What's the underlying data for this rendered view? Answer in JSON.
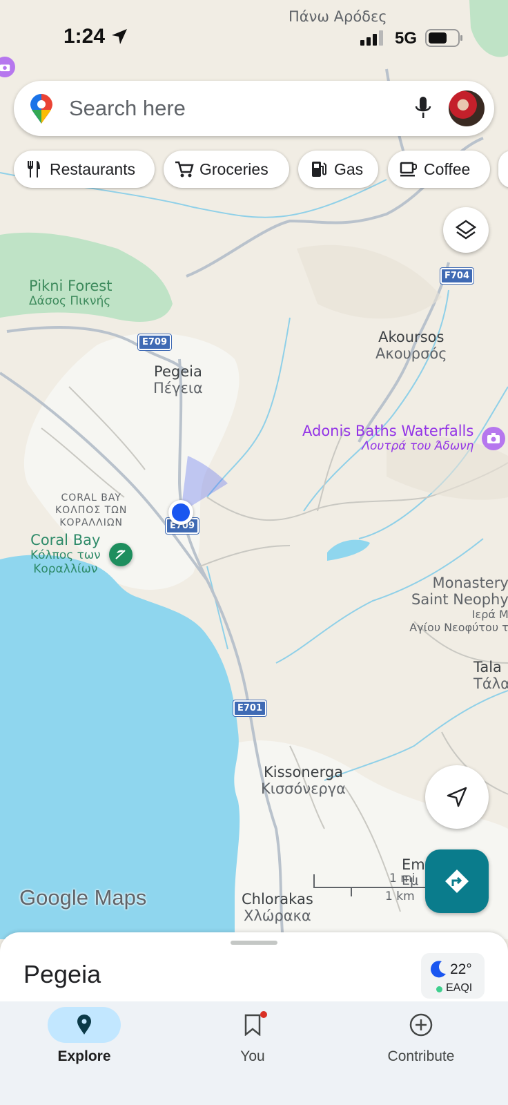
{
  "status_bar": {
    "time": "1:24",
    "network": "5G"
  },
  "search": {
    "placeholder": "Search here"
  },
  "chips": [
    {
      "label": "Restaurants",
      "icon": "fork-knife-icon"
    },
    {
      "label": "Groceries",
      "icon": "cart-icon"
    },
    {
      "label": "Gas",
      "icon": "gas-pump-icon"
    },
    {
      "label": "Coffee",
      "icon": "coffee-cup-icon"
    }
  ],
  "map": {
    "places": {
      "pano_arodes": "Πάνω Αρόδες",
      "pikni_forest": "Pikni Forest",
      "pikni_forest_gr": "Δάσος Πικνής",
      "pegeia": "Pegeia",
      "pegeia_gr": "Πέγεια",
      "akoursos": "Akoursos",
      "akoursos_gr": "Ακουρσός",
      "adonis": "Adonis Baths Waterfalls",
      "adonis_gr": "Λουτρά του Άδωνη",
      "coral_bay_area_1": "CORAL BAY",
      "coral_bay_area_2": "ΚΟΛΠΟΣ ΤΩΝ",
      "coral_bay_area_3": "ΚΟΡΑΛΛΙΩΝ",
      "coral_bay": "Coral Bay",
      "coral_bay_gr_1": "Κόλπος των",
      "coral_bay_gr_2": "Κοραλλίων",
      "monastery_1": "Monastery",
      "monastery_2": "Saint Neophy",
      "monastery_gr_1": "Ιερά Μ",
      "monastery_gr_2": "Αγίου Νεοφύτου τ",
      "tala": "Tala",
      "tala_gr": "Τάλα",
      "kissonerga": "Kissonerga",
      "kissonerga_gr": "Κισσόνεργα",
      "chlorakas": "Chlorakas",
      "chlorakas_gr": "Χλώρακα",
      "em": "Em",
      "em_gr": "Εμ"
    },
    "roads": {
      "e709_a": "E709",
      "e709_b": "E709",
      "e701": "E701",
      "f704": "F704"
    },
    "scale": {
      "mi": "1 mi",
      "km": "1 km"
    },
    "logo": "Google Maps"
  },
  "sheet": {
    "title": "Pegeia",
    "temperature": "22°",
    "air_quality": "EAQI"
  },
  "nav": {
    "explore": "Explore",
    "you": "You",
    "contribute": "Contribute"
  },
  "colors": {
    "water": "#8fd6ee",
    "land": "#f1ede4",
    "forest": "#bfe3c6",
    "accent": "#0a7c8c",
    "poi_purple": "#9334e6",
    "location_blue": "#1a56f0"
  }
}
